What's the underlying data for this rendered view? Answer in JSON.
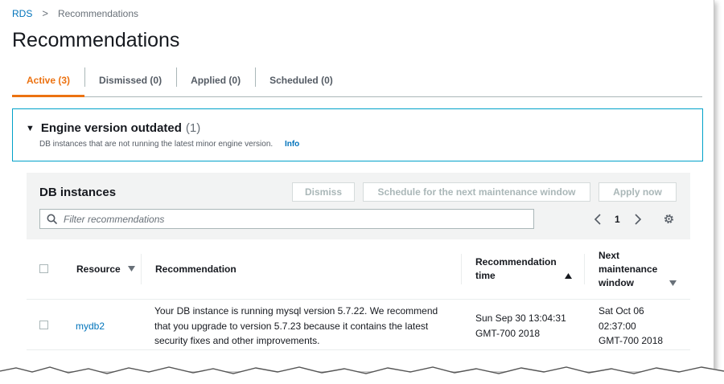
{
  "breadcrumb": {
    "root": "RDS",
    "separator": ">",
    "current": "Recommendations"
  },
  "page": {
    "title": "Recommendations"
  },
  "tabs": [
    {
      "label": "Active (3)",
      "active": true
    },
    {
      "label": "Dismissed (0)",
      "active": false
    },
    {
      "label": "Applied (0)",
      "active": false
    },
    {
      "label": "Scheduled (0)",
      "active": false
    }
  ],
  "panel": {
    "title": "Engine version outdated",
    "count": "(1)",
    "description": "DB instances that are not running the latest minor engine version.",
    "info_link": "Info"
  },
  "db_instances": {
    "title": "DB instances",
    "buttons": {
      "dismiss": "Dismiss",
      "schedule": "Schedule for the next maintenance window",
      "apply": "Apply now"
    },
    "search": {
      "placeholder": "Filter recommendations",
      "value": ""
    },
    "pagination": {
      "current_page": "1"
    },
    "columns": {
      "resource": "Resource",
      "recommendation": "Recommendation",
      "rec_time_line1": "Recommendation",
      "rec_time_line2": "time",
      "maint_line1": "Next",
      "maint_line2": "maintenance",
      "maint_line3": "window"
    },
    "rows": [
      {
        "resource": "mydb2",
        "recommendation_lines": [
          "Your DB instance is running mysql version 5.7.22. We recommend",
          "that you upgrade to version 5.7.23 because it contains the latest",
          "security fixes and other improvements."
        ],
        "time_lines": [
          "Sun Sep 30 13:04:31",
          "GMT-700 2018"
        ],
        "window_lines": [
          "Sat Oct 06",
          "02:37:00",
          "GMT-700 2018"
        ]
      }
    ]
  },
  "colors": {
    "accent": "#ec7211",
    "link": "#0073bb",
    "panel_border": "#00a1c9"
  }
}
